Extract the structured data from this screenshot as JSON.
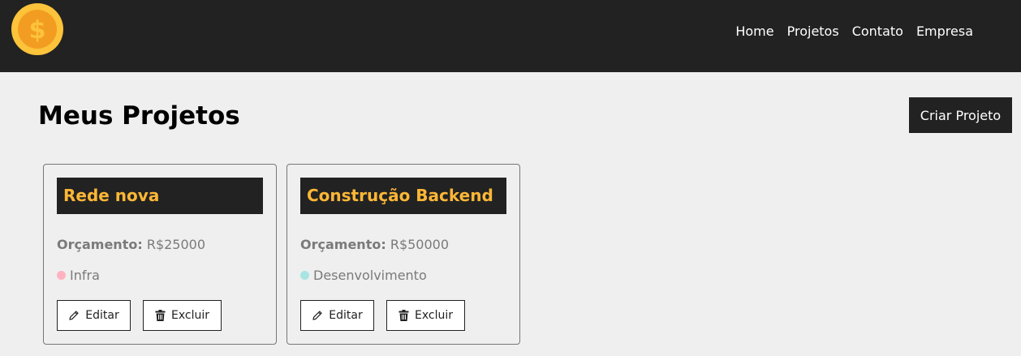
{
  "nav": {
    "logo_icon": "coin-dollar-icon",
    "links": [
      "Home",
      "Projetos",
      "Contato",
      "Empresa"
    ]
  },
  "page": {
    "title": "Meus Projetos",
    "create_label": "Criar Projeto"
  },
  "projects": [
    {
      "name": "Rede nova",
      "budget_label": "Orçamento:",
      "budget_value": "R$25000",
      "category": "Infra",
      "category_color": "#ffb3c0",
      "edit_label": "Editar",
      "delete_label": "Excluir"
    },
    {
      "name": "Construção Backend",
      "budget_label": "Orçamento:",
      "budget_value": "R$50000",
      "category": "Desenvolvimento",
      "category_color": "#a8e4e2",
      "edit_label": "Editar",
      "delete_label": "Excluir"
    }
  ],
  "colors": {
    "navbar": "#222222",
    "accent": "#fdb736",
    "background": "#efefef"
  }
}
